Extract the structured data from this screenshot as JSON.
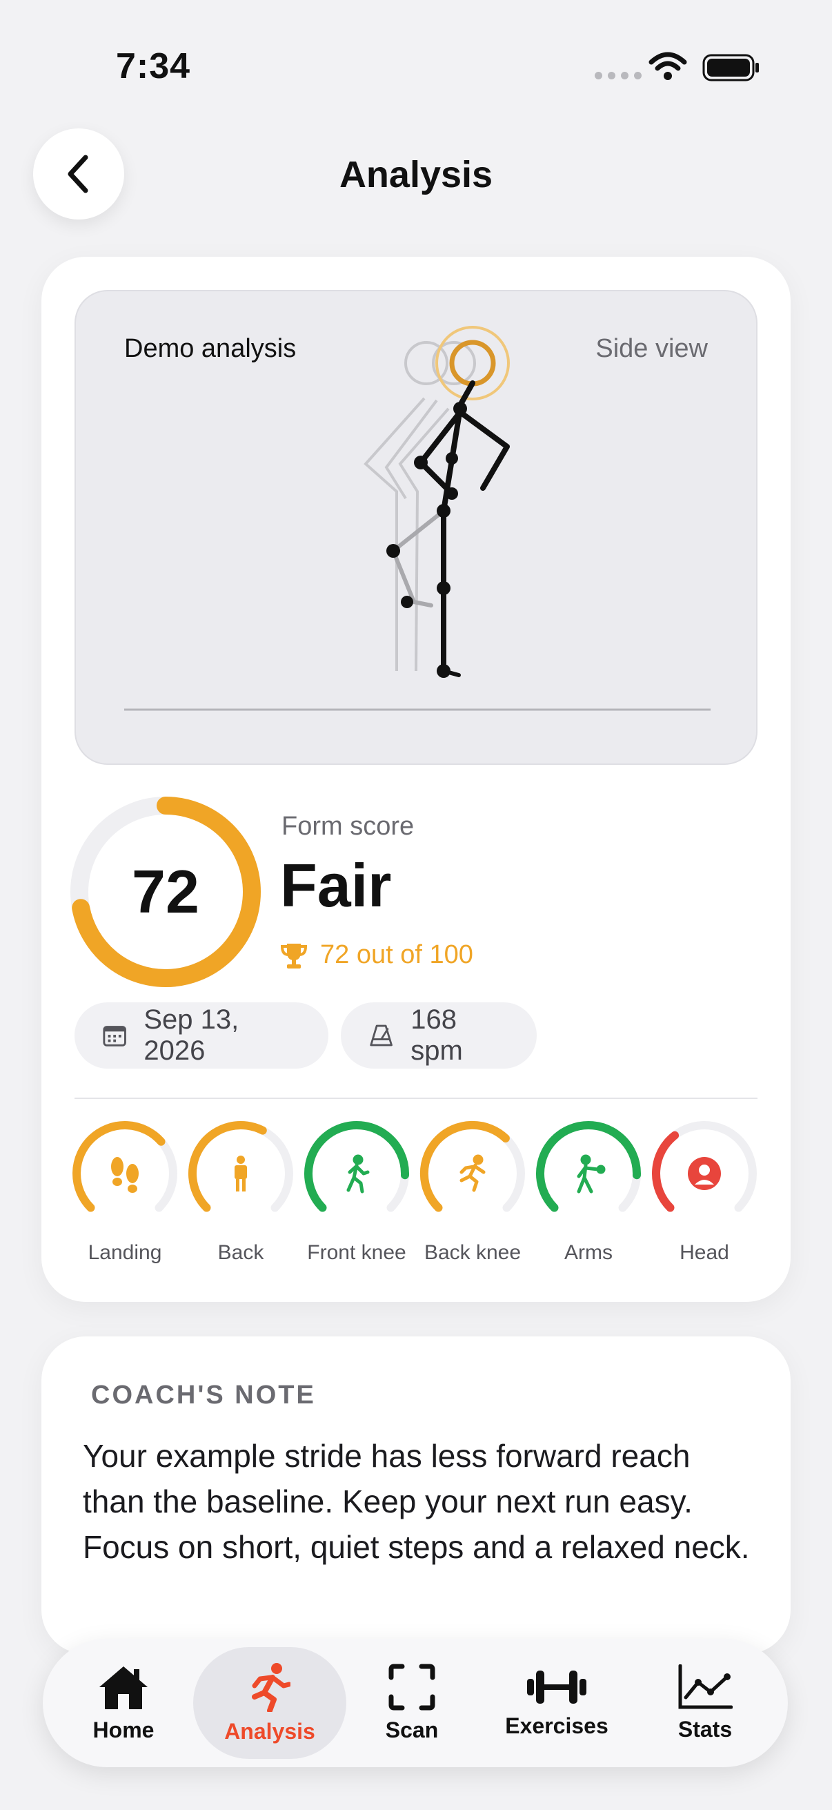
{
  "status_bar": {
    "time": "7:34"
  },
  "header": {
    "title": "Analysis",
    "back_icon": "chevron-left-icon"
  },
  "demo": {
    "label": "Demo analysis",
    "view": "Side view"
  },
  "score": {
    "value": "72",
    "progress": 0.72,
    "caption": "Form score",
    "rating": "Fair",
    "out_of": "72 out of 100",
    "accent": "#f0a526"
  },
  "chips": {
    "date": "Sep 13, 2026",
    "cadence": "168 spm"
  },
  "metrics": [
    {
      "label": "Landing",
      "icon": "footprints-icon",
      "level": 0.68,
      "color": "#f0a526"
    },
    {
      "label": "Back",
      "icon": "standing-person-icon",
      "level": 0.6,
      "color": "#f0a526"
    },
    {
      "label": "Front knee",
      "icon": "walking-person-icon",
      "level": 0.84,
      "color": "#22ac52"
    },
    {
      "label": "Back knee",
      "icon": "running-person-icon",
      "level": 0.66,
      "color": "#f0a526"
    },
    {
      "label": "Arms",
      "icon": "arms-person-icon",
      "level": 0.84,
      "color": "#22ac52"
    },
    {
      "label": "Head",
      "icon": "user-circle-icon",
      "level": 0.36,
      "color": "#e8453c"
    }
  ],
  "coach": {
    "heading": "COACH'S NOTE",
    "body": "Your example stride has less forward reach than the baseline. Keep your next run easy. Focus on short, quiet steps and a relaxed neck."
  },
  "tabs": [
    {
      "label": "Home",
      "icon": "home-icon"
    },
    {
      "label": "Analysis",
      "icon": "running-icon",
      "active": true
    },
    {
      "label": "Scan",
      "icon": "scan-icon"
    },
    {
      "label": "Exercises",
      "icon": "dumbbell-icon"
    },
    {
      "label": "Stats",
      "icon": "line-chart-icon"
    }
  ],
  "colors": {
    "active_tab": "#ee4a2a",
    "good": "#22ac52",
    "warn": "#f0a526",
    "bad": "#e8453c"
  }
}
